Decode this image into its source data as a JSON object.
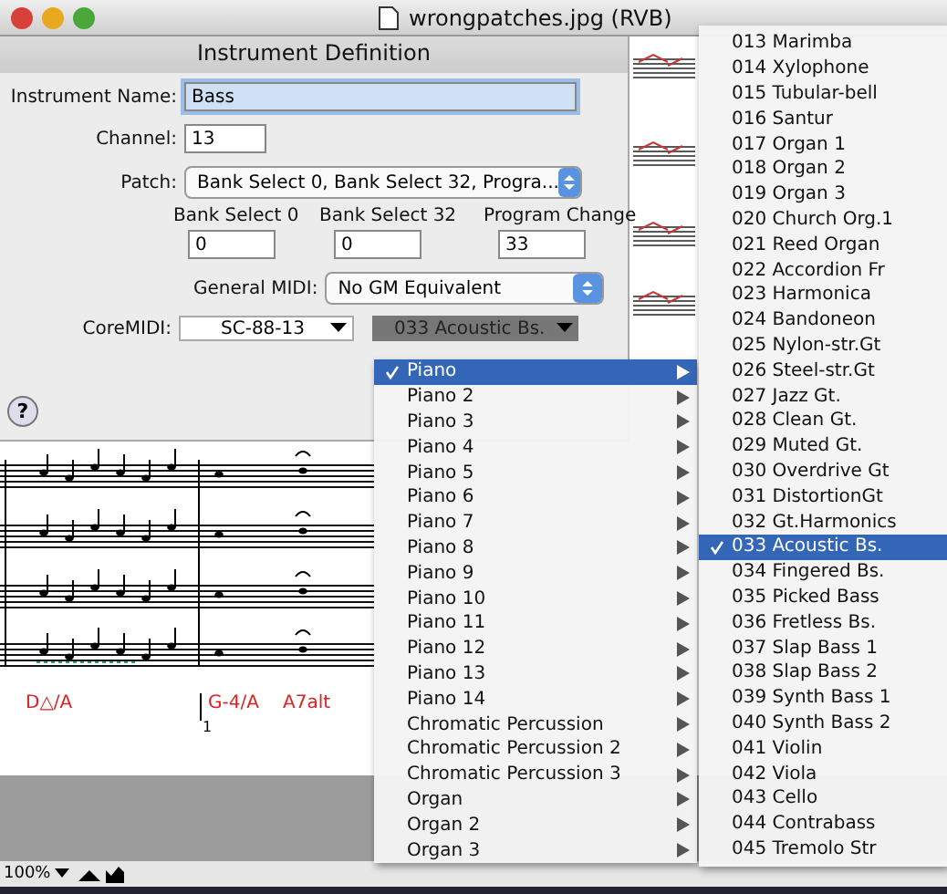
{
  "window": {
    "title": "wrongpatches.jpg (RVB)"
  },
  "sheet": {
    "title": "Instrument Definition",
    "instrument_name": {
      "label": "Instrument Name:",
      "value": "Bass"
    },
    "channel": {
      "label": "Channel:",
      "value": "13"
    },
    "patch": {
      "label": "Patch:",
      "value": "Bank Select 0, Bank Select 32, Progra..."
    },
    "numbers": [
      {
        "label": "Bank Select 0",
        "value": "0"
      },
      {
        "label": "Bank Select 32",
        "value": "0"
      },
      {
        "label": "Program Change",
        "value": "33"
      }
    ],
    "general_midi": {
      "label": "General MIDI:",
      "value": "No GM Equivalent"
    },
    "coremidi": {
      "label": "CoreMIDI:",
      "device": "SC-88-13",
      "program": "033 Acoustic Bs."
    },
    "help_button": "?"
  },
  "score": {
    "chords": [
      {
        "text": "D△/A"
      },
      {
        "text": "G-4/A"
      },
      {
        "text": "A7alt"
      }
    ],
    "ending": "1"
  },
  "status_bar": {
    "zoom": "100%"
  },
  "category_menu": {
    "items": [
      {
        "label": "Piano",
        "selected": true
      },
      {
        "label": "Piano 2",
        "selected": false
      },
      {
        "label": "Piano 3",
        "selected": false
      },
      {
        "label": "Piano 4",
        "selected": false
      },
      {
        "label": "Piano 5",
        "selected": false
      },
      {
        "label": "Piano 6",
        "selected": false
      },
      {
        "label": "Piano 7",
        "selected": false
      },
      {
        "label": "Piano 8",
        "selected": false
      },
      {
        "label": "Piano 9",
        "selected": false
      },
      {
        "label": "Piano 10",
        "selected": false
      },
      {
        "label": "Piano 11",
        "selected": false
      },
      {
        "label": "Piano 12",
        "selected": false
      },
      {
        "label": "Piano 13",
        "selected": false
      },
      {
        "label": "Piano 14",
        "selected": false
      },
      {
        "label": "Chromatic Percussion",
        "selected": false
      },
      {
        "label": "Chromatic Percussion 2",
        "selected": false
      },
      {
        "label": "Chromatic Percussion 3",
        "selected": false
      },
      {
        "label": "Organ",
        "selected": false
      },
      {
        "label": "Organ 2",
        "selected": false
      },
      {
        "label": "Organ 3",
        "selected": false
      }
    ]
  },
  "program_menu": {
    "items": [
      {
        "label": "013 Marimba",
        "selected": false
      },
      {
        "label": "014 Xylophone",
        "selected": false
      },
      {
        "label": "015 Tubular-bell",
        "selected": false
      },
      {
        "label": "016 Santur",
        "selected": false
      },
      {
        "label": "017 Organ 1",
        "selected": false
      },
      {
        "label": "018 Organ 2",
        "selected": false
      },
      {
        "label": "019 Organ 3",
        "selected": false
      },
      {
        "label": "020 Church Org.1",
        "selected": false
      },
      {
        "label": "021 Reed Organ",
        "selected": false
      },
      {
        "label": "022 Accordion Fr",
        "selected": false
      },
      {
        "label": "023 Harmonica",
        "selected": false
      },
      {
        "label": "024 Bandoneon",
        "selected": false
      },
      {
        "label": "025 Nylon-str.Gt",
        "selected": false
      },
      {
        "label": "026 Steel-str.Gt",
        "selected": false
      },
      {
        "label": "027 Jazz Gt.",
        "selected": false
      },
      {
        "label": "028 Clean Gt.",
        "selected": false
      },
      {
        "label": "029 Muted Gt.",
        "selected": false
      },
      {
        "label": "030 Overdrive Gt",
        "selected": false
      },
      {
        "label": "031 DistortionGt",
        "selected": false
      },
      {
        "label": "032 Gt.Harmonics",
        "selected": false
      },
      {
        "label": "033 Acoustic Bs.",
        "selected": true
      },
      {
        "label": "034 Fingered Bs.",
        "selected": false
      },
      {
        "label": "035 Picked Bass",
        "selected": false
      },
      {
        "label": "036 Fretless Bs.",
        "selected": false
      },
      {
        "label": "037 Slap Bass 1",
        "selected": false
      },
      {
        "label": "038 Slap Bass 2",
        "selected": false
      },
      {
        "label": "039 Synth Bass 1",
        "selected": false
      },
      {
        "label": "040 Synth Bass 2",
        "selected": false
      },
      {
        "label": "041 Violin",
        "selected": false
      },
      {
        "label": "042 Viola",
        "selected": false
      },
      {
        "label": "043 Cello",
        "selected": false
      },
      {
        "label": "044 Contrabass",
        "selected": false
      },
      {
        "label": "045 Tremolo Str",
        "selected": false
      }
    ]
  }
}
